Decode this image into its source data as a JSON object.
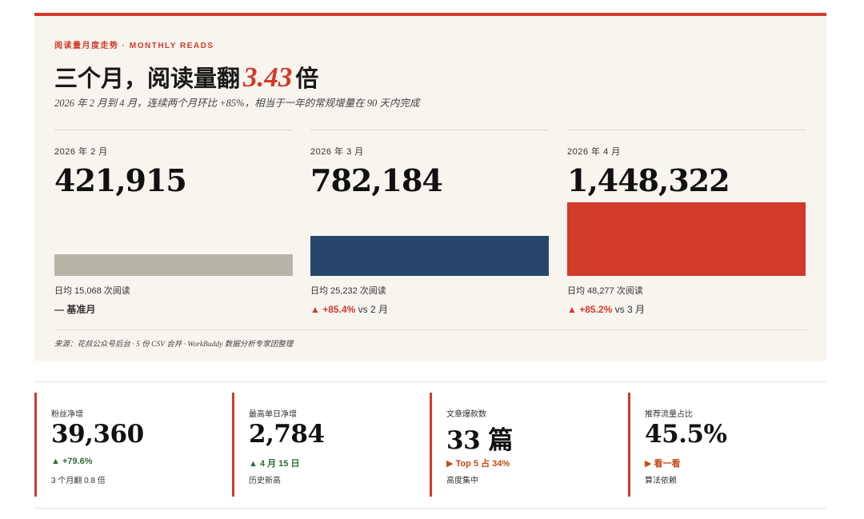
{
  "header": {
    "kicker": "阅读量月度走势 · MONTHLY READS",
    "headline_pre": "三个月，阅读量翻",
    "headline_accent": "3.43",
    "headline_post": "倍",
    "subtitle": "2026 年 2 月到 4 月，连续两个月环比 +85%，相当于一年的常规增量在 90 天内完成"
  },
  "chart_data": {
    "type": "bar",
    "categories": [
      "2026 年 2 月",
      "2026 年 3 月",
      "2026 年 4 月"
    ],
    "values": [
      421915,
      782184,
      1448322
    ],
    "value_labels": [
      "421,915",
      "782,184",
      "1,448,322"
    ],
    "colors": [
      "#b8b4a8",
      "#27466c",
      "#d23a2a"
    ],
    "daily": [
      "日均 15,068 次阅读",
      "日均 25,232 次阅读",
      "日均 48,277 次阅读"
    ],
    "changes": [
      {
        "arrow": "",
        "pct": "",
        "text": "— 基准月"
      },
      {
        "arrow": "▲",
        "pct": "+85.4%",
        "text": "vs 2 月"
      },
      {
        "arrow": "▲",
        "pct": "+85.2%",
        "text": "vs 3 月"
      }
    ],
    "ylim": [
      0,
      1600000
    ],
    "grid": false
  },
  "source": "来源：花叔公众号后台 · 5 份 CSV 合并 · WorkBuddy 数据分析专家团整理",
  "kpis": [
    {
      "label": "粉丝净增",
      "value": "39,360",
      "delta": "▲ +79.6%",
      "tone": "up",
      "note": "3 个月翻 0.8 倍"
    },
    {
      "label": "最高单日净增",
      "value": "2,784",
      "delta": "▲ 4 月 15 日",
      "tone": "up",
      "note": "历史新高"
    },
    {
      "label": "文章爆款数",
      "value": "33 篇",
      "delta": "▶ Top 5 占 34%",
      "tone": "hot",
      "note": "高度集中"
    },
    {
      "label": "推荐流量占比",
      "value": "45.5%",
      "delta": "▶ 看一看",
      "tone": "hot",
      "note": "算法依赖"
    }
  ],
  "colors": {
    "accent": "#d23a2a",
    "navy": "#27466c",
    "grey": "#b8b4a8",
    "green": "#2e6a3a",
    "orange": "#c24a14",
    "panel": "#f8f4ee"
  }
}
